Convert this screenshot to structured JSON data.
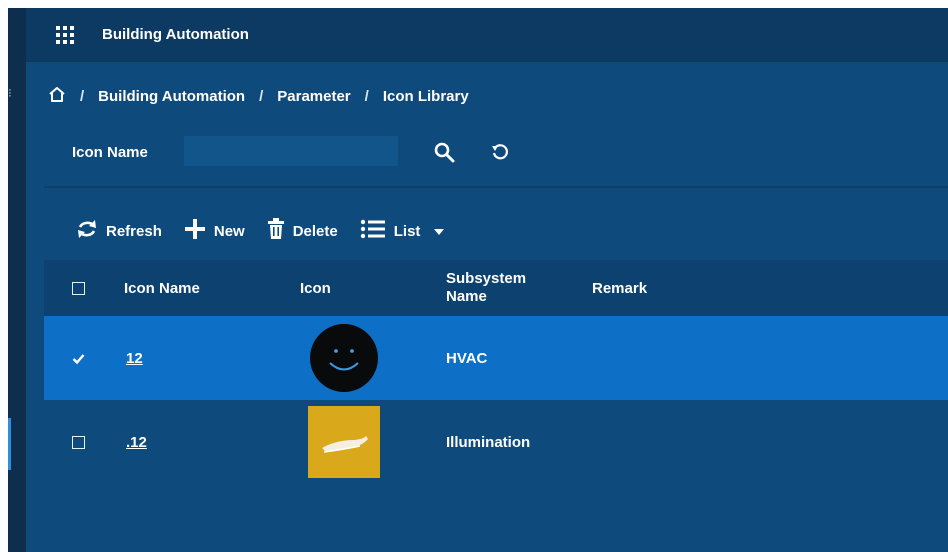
{
  "app": {
    "title": "Building Automation"
  },
  "breadcrumb": {
    "items": [
      "Building Automation",
      "Parameter",
      "Icon Library"
    ],
    "separator": "/"
  },
  "search": {
    "label": "Icon Name",
    "value": "",
    "placeholder": ""
  },
  "toolbar": {
    "refresh_label": "Refresh",
    "new_label": "New",
    "delete_label": "Delete",
    "list_label": "List"
  },
  "table": {
    "columns": [
      "Icon Name",
      "Icon",
      "Subsystem\nName",
      "Remark"
    ],
    "rows": [
      {
        "name": "12",
        "icon": "smiley-face-icon",
        "subsystem": "HVAC",
        "remark": "",
        "selected": true
      },
      {
        "name": ".12",
        "icon": "yellow-shoe-icon",
        "subsystem": "Illumination",
        "remark": "",
        "selected": false
      }
    ]
  },
  "colors": {
    "background": "#0f4a7c",
    "header": "#0c3a62",
    "selected_row": "#0e6fc6"
  }
}
